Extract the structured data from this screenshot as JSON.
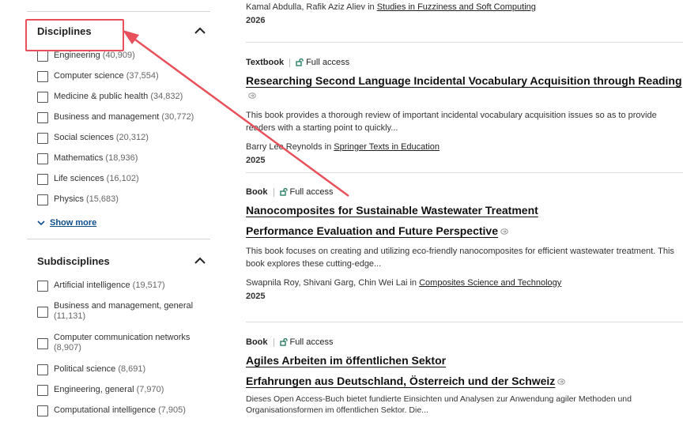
{
  "sidebar": {
    "disciplines": {
      "title": "Disciplines",
      "items": [
        {
          "label": "Engineering",
          "count": "(40,909)"
        },
        {
          "label": "Computer science",
          "count": "(37,554)"
        },
        {
          "label": "Medicine & public health",
          "count": "(34,832)"
        },
        {
          "label": "Business and management",
          "count": "(30,772)"
        },
        {
          "label": "Social sciences",
          "count": "(20,312)"
        },
        {
          "label": "Mathematics",
          "count": "(18,936)"
        },
        {
          "label": "Life sciences",
          "count": "(16,102)"
        },
        {
          "label": "Physics",
          "count": "(15,683)"
        }
      ],
      "show_more": "Show more"
    },
    "subdisciplines": {
      "title": "Subdisciplines",
      "items": [
        {
          "label": "Artificial intelligence",
          "count": "(19,517)"
        },
        {
          "label": "Business and management, general",
          "count": "(11,131)"
        },
        {
          "label": "Computer communication networks",
          "count": "(8,907)"
        },
        {
          "label": "Political science",
          "count": "(8,691)"
        },
        {
          "label": "Engineering, general",
          "count": "(7,970)"
        },
        {
          "label": "Computational intelligence",
          "count": "(7,905)"
        }
      ]
    }
  },
  "results": [
    {
      "authors": "Kamal Abdulla, Rafik Aziz Aliev",
      "in": "in",
      "series": "Studies in Fuzziness and Soft Computing",
      "year": "2026"
    },
    {
      "type": "Textbook",
      "access": "Full access",
      "title": "Researching Second Language Incidental Vocabulary Acquisition through Reading",
      "description": "This book provides a thorough review of important incidental vocabulary acquisition issues so as to provide readers with a starting point to quickly...",
      "authors": "Barry Lee Reynolds",
      "in": "in",
      "series": "Springer Texts in Education",
      "year": "2025"
    },
    {
      "type": "Book",
      "access": "Full access",
      "title_line1": "Nanocomposites for Sustainable Wastewater Treatment",
      "title_line2": "Performance Evaluation and Future Perspective",
      "description": "This book focuses on creating and utilizing eco-friendly nanocomposites for efficient wastewater treatment. This book explores these cutting-edge...",
      "authors": "Swapnila Roy, Shivani Garg, Chin Wei Lai",
      "in": "in",
      "series": "Composites Science and Technology",
      "year": "2025"
    },
    {
      "type": "Book",
      "access": "Full access",
      "title_line1": "Agiles Arbeiten im öffentlichen Sektor",
      "title_line2": "Erfahrungen aus Deutschland, Österreich und der Schweiz",
      "description": "Dieses Open Access-Buch bietet fundierte Einsichten und Analysen zur Anwendung agiler Methoden und Organisationsformen im öffentlichen Sektor. Die..."
    }
  ],
  "annotation": {
    "color": "#e8505b"
  }
}
